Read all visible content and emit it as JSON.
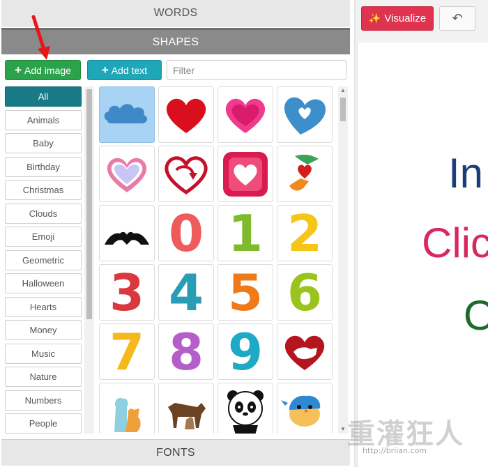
{
  "accordion": {
    "words_label": "WORDS",
    "shapes_label": "SHAPES",
    "fonts_label": "FONTS"
  },
  "toolbar": {
    "add_image_label": "Add image",
    "add_text_label": "Add text",
    "filter_placeholder": "Filter"
  },
  "categories": [
    "All",
    "Animals",
    "Baby",
    "Birthday",
    "Christmas",
    "Clouds",
    "Emoji",
    "Geometric",
    "Halloween",
    "Hearts",
    "Money",
    "Music",
    "Nature",
    "Numbers",
    "People"
  ],
  "active_category": "All",
  "shapes": [
    {
      "name": "cloud-shape",
      "selected": true
    },
    {
      "name": "red-heart-shape"
    },
    {
      "name": "pink-heart-shape"
    },
    {
      "name": "blue-heart-shape"
    },
    {
      "name": "heart-outline-shape"
    },
    {
      "name": "heart-arrow-shape"
    },
    {
      "name": "heart-square-shape"
    },
    {
      "name": "hands-heart-shape"
    },
    {
      "name": "hand-heart-shape"
    },
    {
      "name": "digit",
      "digit": "0",
      "color": "#ef5b5b"
    },
    {
      "name": "digit",
      "digit": "1",
      "color": "#7dbb2c"
    },
    {
      "name": "digit",
      "digit": "2",
      "color": "#f5c518"
    },
    {
      "name": "digit",
      "digit": "3",
      "color": "#d9383e"
    },
    {
      "name": "digit",
      "digit": "4",
      "color": "#2a9db6"
    },
    {
      "name": "digit",
      "digit": "5",
      "color": "#f07a1a"
    },
    {
      "name": "digit",
      "digit": "6",
      "color": "#9ac31c"
    },
    {
      "name": "digit",
      "digit": "7",
      "color": "#f5b91c"
    },
    {
      "name": "digit",
      "digit": "8",
      "color": "#b45fc9"
    },
    {
      "name": "digit",
      "digit": "9",
      "color": "#1eaac6"
    },
    {
      "name": "pet-heart-shape"
    },
    {
      "name": "cat-dog-shape"
    },
    {
      "name": "dogs-shape"
    },
    {
      "name": "panda-shape"
    },
    {
      "name": "bird-shape"
    }
  ],
  "right": {
    "visualize_label": "Visualize",
    "canvas_text": [
      "In",
      "Clic",
      "O"
    ]
  },
  "watermark": {
    "text": "重灌狂人",
    "url": "http://briian.com"
  },
  "colors": {
    "add_image": "#2aa34a",
    "add_text": "#1ea7b8",
    "visualize": "#e0334f",
    "active_category": "#177a86",
    "shapes_bar": "#8a8a8a"
  }
}
